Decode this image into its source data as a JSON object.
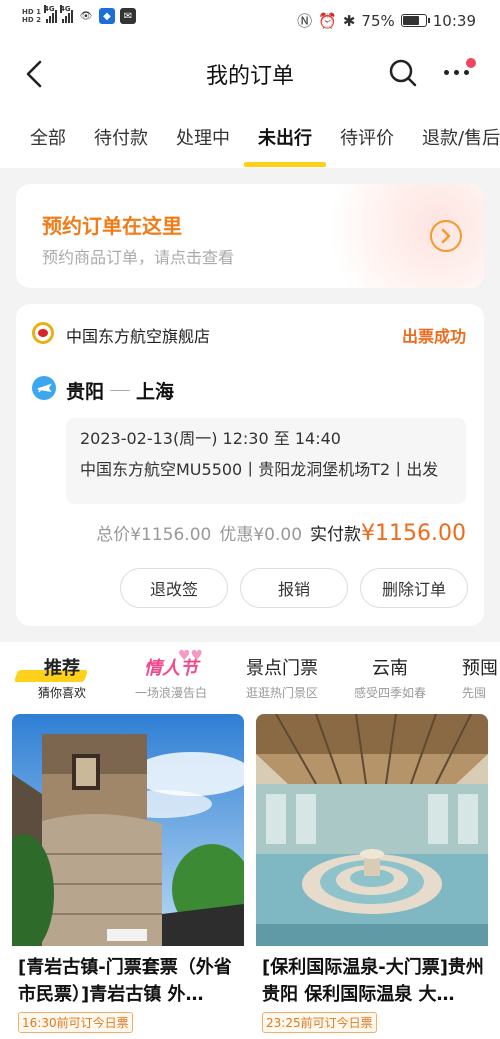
{
  "statusbar": {
    "hd1": "HD 1",
    "hd2": "HD 2",
    "net1": "4G",
    "net2": "4G",
    "battery_text": "75%",
    "battery_level": 0.75,
    "time": "10:39"
  },
  "nav": {
    "title": "我的订单"
  },
  "tabs": [
    "全部",
    "待付款",
    "处理中",
    "未出行",
    "待评价",
    "退款/售后"
  ],
  "active_tab": "未出行",
  "banner": {
    "title": "预约订单在这里",
    "subtitle": "预约商品订单，请点击查看"
  },
  "order": {
    "shop_name": "中国东方航空旗舰店",
    "status": "出票成功",
    "from": "贵阳",
    "to": "上海",
    "datetime": "2023-02-13(周一) 12:30 至 14:40",
    "flight_info": "中国东方航空MU5500丨贵阳龙洞堡机场T2丨出发",
    "total": "总价¥1156.00",
    "discount": "优惠¥0.00",
    "paid_label": "实付款",
    "paid_amount": "¥1156.00",
    "buttons": [
      "退改签",
      "报销",
      "删除订单"
    ]
  },
  "rec_tabs": [
    {
      "title": "推荐",
      "sub": "猜你喜欢"
    },
    {
      "title": "情人节",
      "sub": "一场浪漫告白"
    },
    {
      "title": "景点门票",
      "sub": "逛逛热门景区"
    },
    {
      "title": "云南",
      "sub": "感受四季如春"
    },
    {
      "title": "预囤",
      "sub": "先囤"
    }
  ],
  "products": [
    {
      "title": "[青岩古镇-门票套票（外省市民票）]青岩古镇 外…",
      "tag": "16:30前可订今日票"
    },
    {
      "title": "[保利国际温泉-大门票]贵州贵阳 保利国际温泉 大…",
      "tag": "23:25前可订今日票"
    }
  ],
  "colors": {
    "accent": "#ffcf1a",
    "orange": "#f06a1c",
    "valentine": "#f04a8e"
  }
}
